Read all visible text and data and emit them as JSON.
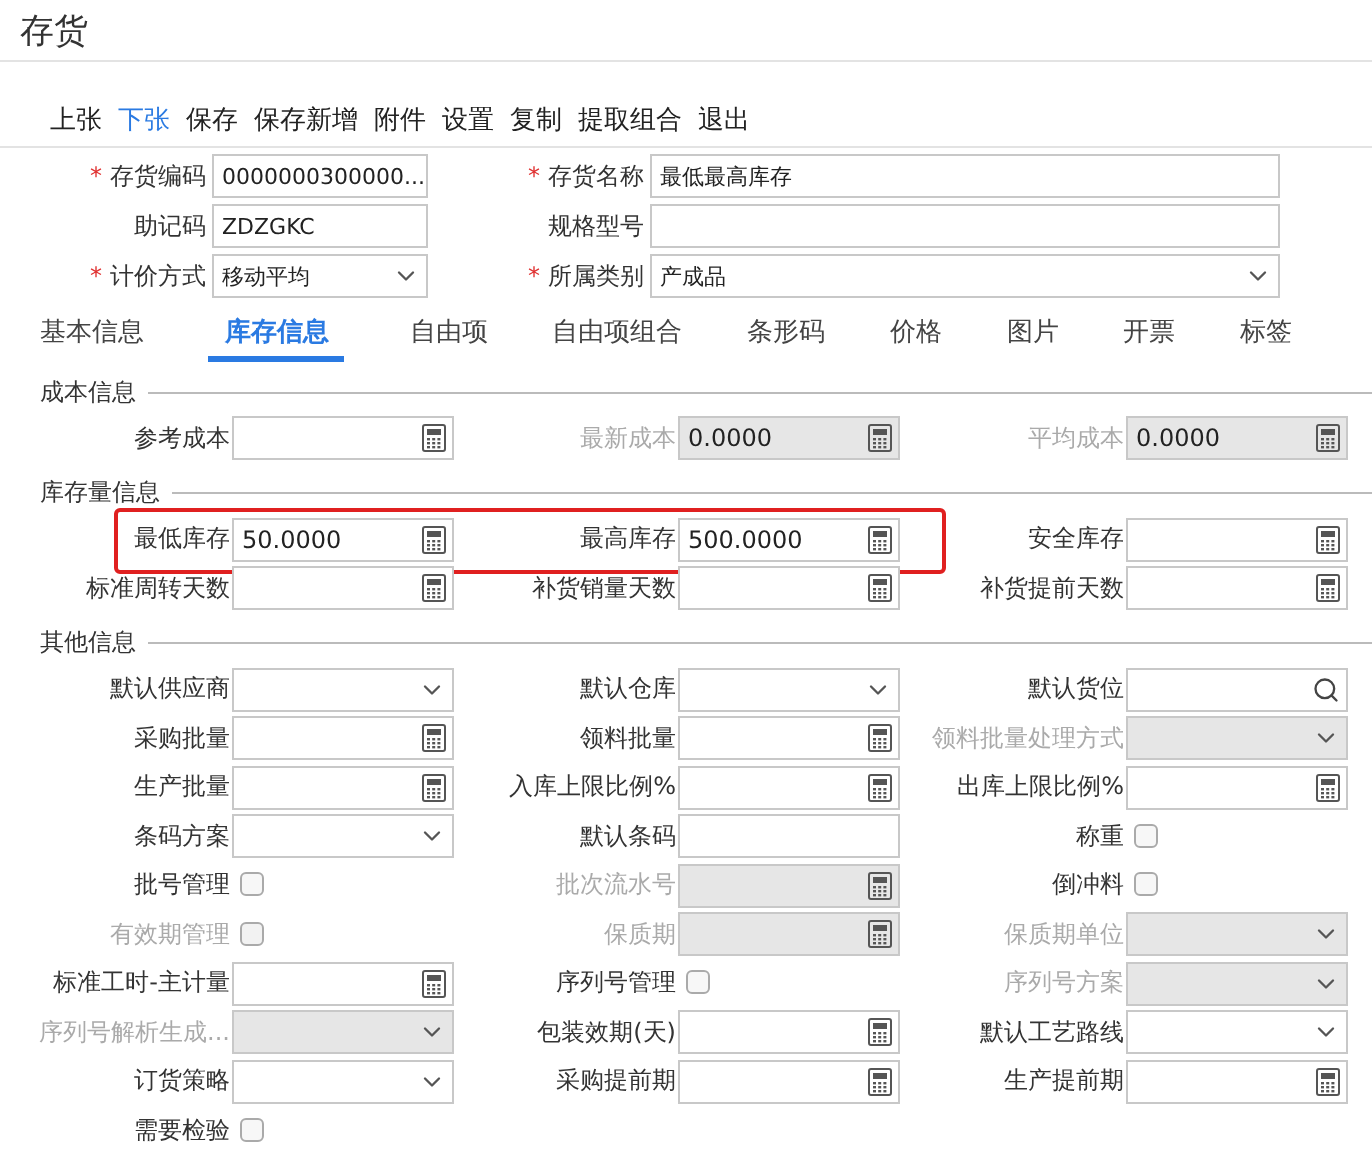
{
  "window": {
    "title": "存货"
  },
  "toolbar": [
    {
      "label": "上张",
      "selected": false
    },
    {
      "label": "下张",
      "selected": true
    },
    {
      "label": "保存",
      "selected": false
    },
    {
      "label": "保存新增",
      "selected": false
    },
    {
      "label": "附件",
      "selected": false
    },
    {
      "label": "设置",
      "selected": false
    },
    {
      "label": "复制",
      "selected": false
    },
    {
      "label": "提取组合",
      "selected": false
    },
    {
      "label": "退出",
      "selected": false
    }
  ],
  "header_rows": [
    [
      {
        "marker": "*",
        "label": "存货编码",
        "kind": "text",
        "value": "0000000300000..."
      },
      {
        "marker": "*",
        "label": "存货名称",
        "kind": "text",
        "value": "最低最高库存"
      }
    ],
    [
      {
        "label": "助记码",
        "kind": "text",
        "value": "ZDZGKC"
      },
      {
        "label": "规格型号",
        "kind": "text"
      }
    ],
    [
      {
        "marker": "*",
        "label": "计价方式",
        "kind": "select",
        "value": "移动平均"
      },
      {
        "marker": "*",
        "label": "所属类别",
        "kind": "select",
        "value": "产成品"
      }
    ]
  ],
  "tabs": [
    {
      "label": "基本信息",
      "selected": false
    },
    {
      "label": "库存信息",
      "selected": true
    },
    {
      "label": "自由项",
      "selected": false
    },
    {
      "label": "自由项组合",
      "selected": false
    },
    {
      "label": "条形码",
      "selected": false
    },
    {
      "label": "价格",
      "selected": false
    },
    {
      "label": "图片",
      "selected": false
    },
    {
      "label": "开票",
      "selected": false
    },
    {
      "label": "标签",
      "selected": false
    }
  ],
  "sections": [
    {
      "title": "成本信息",
      "rows": [
        {
          "highlighted": false,
          "cells": [
            {
              "label": "参考成本",
              "kind": "calc",
              "disabled": false
            },
            {
              "label": "最新成本",
              "kind": "calc",
              "disabled": true,
              "value": "0.0000"
            },
            {
              "label": "平均成本",
              "kind": "calc",
              "disabled": true,
              "value": "0.0000"
            }
          ]
        }
      ]
    },
    {
      "title": "库存量信息",
      "rows": [
        {
          "highlighted": true,
          "cells": [
            {
              "label": "最低库存",
              "kind": "calc",
              "disabled": false,
              "value": "50.0000"
            },
            {
              "label": "最高库存",
              "kind": "calc",
              "disabled": false,
              "value": "500.0000"
            },
            {
              "label": "安全库存",
              "kind": "calc",
              "disabled": false
            }
          ]
        },
        {
          "highlighted": false,
          "cells": [
            {
              "label": "标准周转天数",
              "kind": "calc",
              "disabled": false
            },
            {
              "label": "补货销量天数",
              "kind": "calc",
              "disabled": false
            },
            {
              "label": "补货提前天数",
              "kind": "calc",
              "disabled": false
            }
          ]
        }
      ]
    },
    {
      "title": "其他信息",
      "rows": [
        {
          "highlighted": false,
          "cells": [
            {
              "label": "默认供应商",
              "kind": "select",
              "disabled": false
            },
            {
              "label": "默认仓库",
              "kind": "select",
              "disabled": false
            },
            {
              "label": "默认货位",
              "kind": "search",
              "disabled": false
            }
          ]
        },
        {
          "highlighted": false,
          "cells": [
            {
              "label": "采购批量",
              "kind": "calc",
              "disabled": false
            },
            {
              "label": "领料批量",
              "kind": "calc",
              "disabled": false
            },
            {
              "label": "领料批量处理方式",
              "kind": "select",
              "disabled": true
            }
          ]
        },
        {
          "highlighted": false,
          "cells": [
            {
              "label": "生产批量",
              "kind": "calc",
              "disabled": false
            },
            {
              "label": "入库上限比例%",
              "kind": "calc",
              "disabled": false
            },
            {
              "label": "出库上限比例%",
              "kind": "calc",
              "disabled": false
            }
          ]
        },
        {
          "highlighted": false,
          "cells": [
            {
              "label": "条码方案",
              "kind": "select",
              "disabled": false
            },
            {
              "label": "默认条码",
              "kind": "text",
              "disabled": false
            },
            {
              "label": "称重",
              "kind": "checkbox",
              "disabled": false,
              "checked": false
            }
          ]
        },
        {
          "highlighted": false,
          "cells": [
            {
              "label": "批号管理",
              "kind": "checkbox",
              "disabled": false,
              "checked": false
            },
            {
              "label": "批次流水号",
              "kind": "calc",
              "disabled": true
            },
            {
              "label": "倒冲料",
              "kind": "checkbox",
              "disabled": false,
              "checked": false
            }
          ]
        },
        {
          "highlighted": false,
          "cells": [
            {
              "label": "有效期管理",
              "kind": "checkbox",
              "disabled": true,
              "checked": false
            },
            {
              "label": "保质期",
              "kind": "calc",
              "disabled": true
            },
            {
              "label": "保质期单位",
              "kind": "select",
              "disabled": true
            }
          ]
        },
        {
          "highlighted": false,
          "cells": [
            {
              "label": "标准工时-主计量",
              "kind": "calc",
              "disabled": false
            },
            {
              "label": "序列号管理",
              "kind": "checkbox",
              "disabled": false,
              "checked": false
            },
            {
              "label": "序列号方案",
              "kind": "select",
              "disabled": true
            }
          ]
        },
        {
          "highlighted": false,
          "cells": [
            {
              "label": "序列号解析生成...",
              "kind": "select",
              "disabled": true
            },
            {
              "label": "包装效期(天)",
              "kind": "calc",
              "disabled": false
            },
            {
              "label": "默认工艺路线",
              "kind": "select",
              "disabled": false
            }
          ]
        },
        {
          "highlighted": false,
          "cells": [
            {
              "label": "订货策略",
              "kind": "select",
              "disabled": false
            },
            {
              "label": "采购提前期",
              "kind": "calc",
              "disabled": false
            },
            {
              "label": "生产提前期",
              "kind": "calc",
              "disabled": false
            }
          ]
        },
        {
          "highlighted": false,
          "cells": [
            {
              "label": "需要检验",
              "kind": "checkbox",
              "disabled": false,
              "checked": false
            }
          ]
        }
      ]
    }
  ]
}
